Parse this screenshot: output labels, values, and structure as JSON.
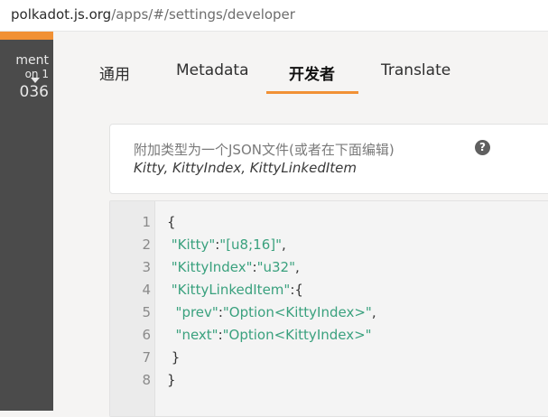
{
  "browser": {
    "url_host": "polkadot.js.org",
    "url_path": "/apps/#/settings/developer"
  },
  "sidebar": {
    "chain_line1": "ment",
    "chain_line2": "on 1",
    "chain_line3": "036"
  },
  "tabs": [
    {
      "label": "通用",
      "active": false
    },
    {
      "label": "Metadata",
      "active": false
    },
    {
      "label": "开发者",
      "active": true
    },
    {
      "label": "Translate",
      "active": false
    }
  ],
  "types_card": {
    "label": "附加类型为一个JSON文件(或者在下面编辑)",
    "value": "Kitty, KittyIndex, KittyLinkedItem",
    "help_icon": "question-circle-icon"
  },
  "editor": {
    "lines": [
      {
        "no": "1"
      },
      {
        "no": "2",
        "key": "\"Kitty\"",
        "val": "\"[u8;16]\"",
        "end": ","
      },
      {
        "no": "3",
        "key": "\"KittyIndex\"",
        "val": "\"u32\"",
        "end": ","
      },
      {
        "no": "4",
        "key": "\"KittyLinkedItem\"",
        "end": ":{"
      },
      {
        "no": "5",
        "key": "\"prev\"",
        "val": "\"Option<KittyIndex>\"",
        "end": ","
      },
      {
        "no": "6",
        "key": "\"next\"",
        "val": "\"Option<KittyIndex>\""
      },
      {
        "no": "7"
      },
      {
        "no": "8"
      }
    ],
    "brace_open": "{",
    "brace_close": "}",
    "inner_close": "}",
    "colon": ":"
  }
}
